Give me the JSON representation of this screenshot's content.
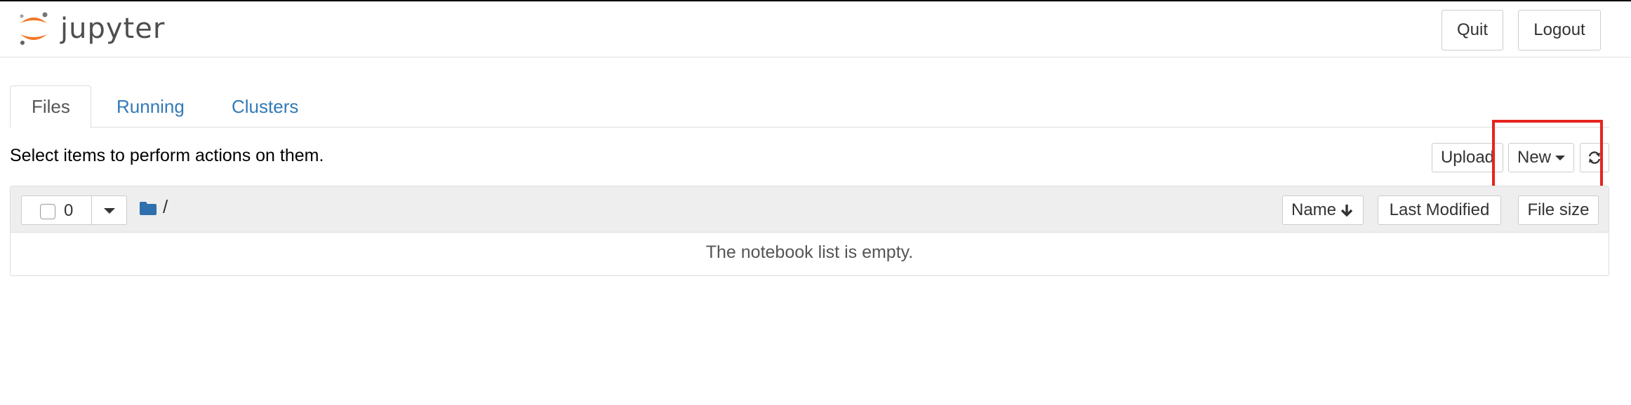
{
  "header": {
    "logo_text": "jupyter",
    "quit_label": "Quit",
    "logout_label": "Logout"
  },
  "tabs": [
    {
      "label": "Files",
      "active": true
    },
    {
      "label": "Running",
      "active": false
    },
    {
      "label": "Clusters",
      "active": false
    }
  ],
  "toolbar": {
    "hint": "Select items to perform actions on them.",
    "upload_label": "Upload",
    "new_label": "New"
  },
  "list": {
    "selected_count": "0",
    "path": "/",
    "columns": {
      "name": "Name",
      "last_modified": "Last Modified",
      "file_size": "File size"
    },
    "empty_message": "The notebook list is empty."
  },
  "colors": {
    "link": "#337ab7",
    "highlight_box": "#e8231f",
    "logo_orange": "#f37726",
    "folder": "#2f6fad"
  },
  "icons": {
    "logo": "jupyter-logo-icon",
    "new_caret": "caret-down-icon",
    "refresh": "refresh-icon",
    "folder": "folder-icon",
    "sort": "arrow-down-icon"
  }
}
